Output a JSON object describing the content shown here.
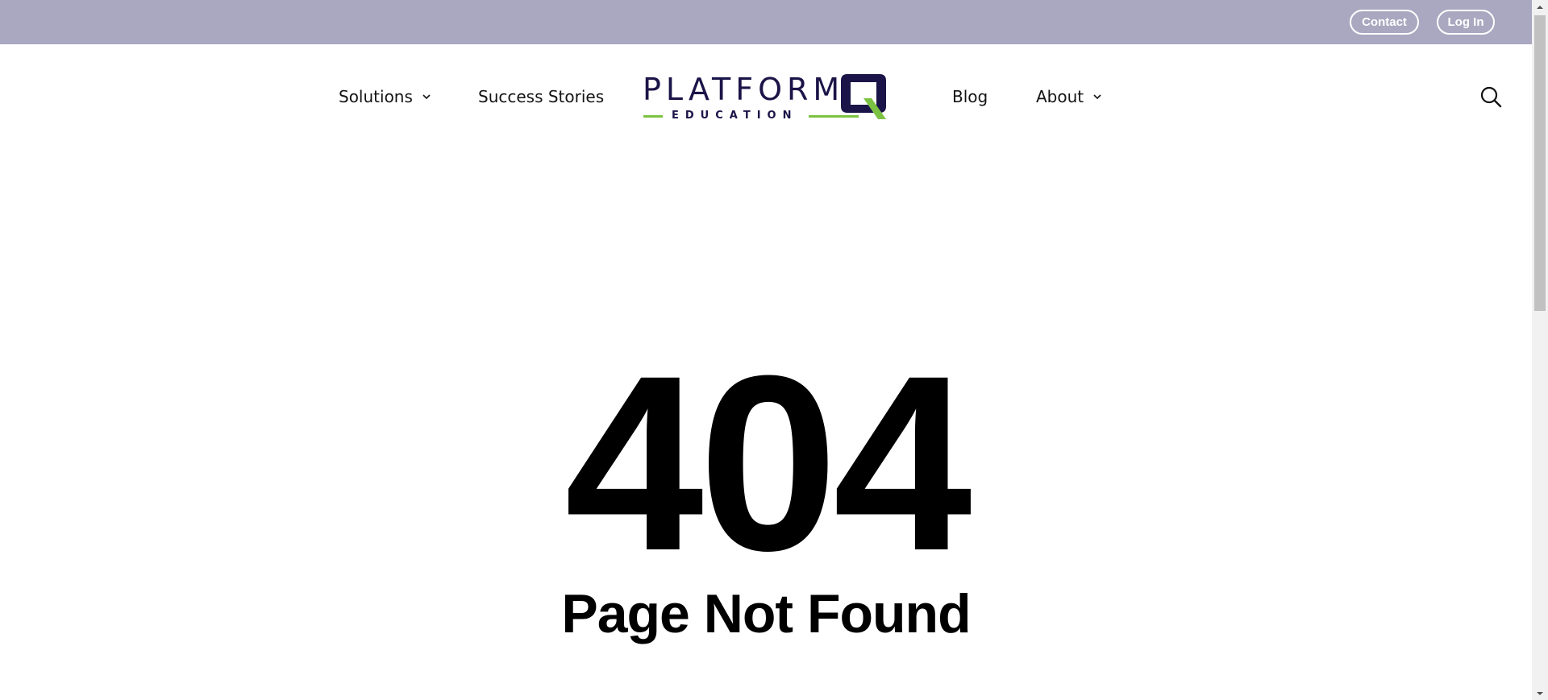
{
  "topbar": {
    "contact_label": "Contact",
    "login_label": "Log In",
    "bg_color": "#aaa7c0"
  },
  "nav": {
    "items": [
      {
        "label": "Solutions",
        "has_dropdown": true
      },
      {
        "label": "Success Stories",
        "has_dropdown": false
      },
      {
        "label": "Blog",
        "has_dropdown": false
      },
      {
        "label": "About",
        "has_dropdown": true
      }
    ]
  },
  "logo": {
    "wordmark": "PLATFORM",
    "subtext": "EDUCATION",
    "brand_color": "#1b1448",
    "accent_color": "#7cc242"
  },
  "icons": {
    "search": "search-icon",
    "dropdown": "chevron-down-icon"
  },
  "main": {
    "error_code": "404",
    "message": "Page Not Found"
  }
}
